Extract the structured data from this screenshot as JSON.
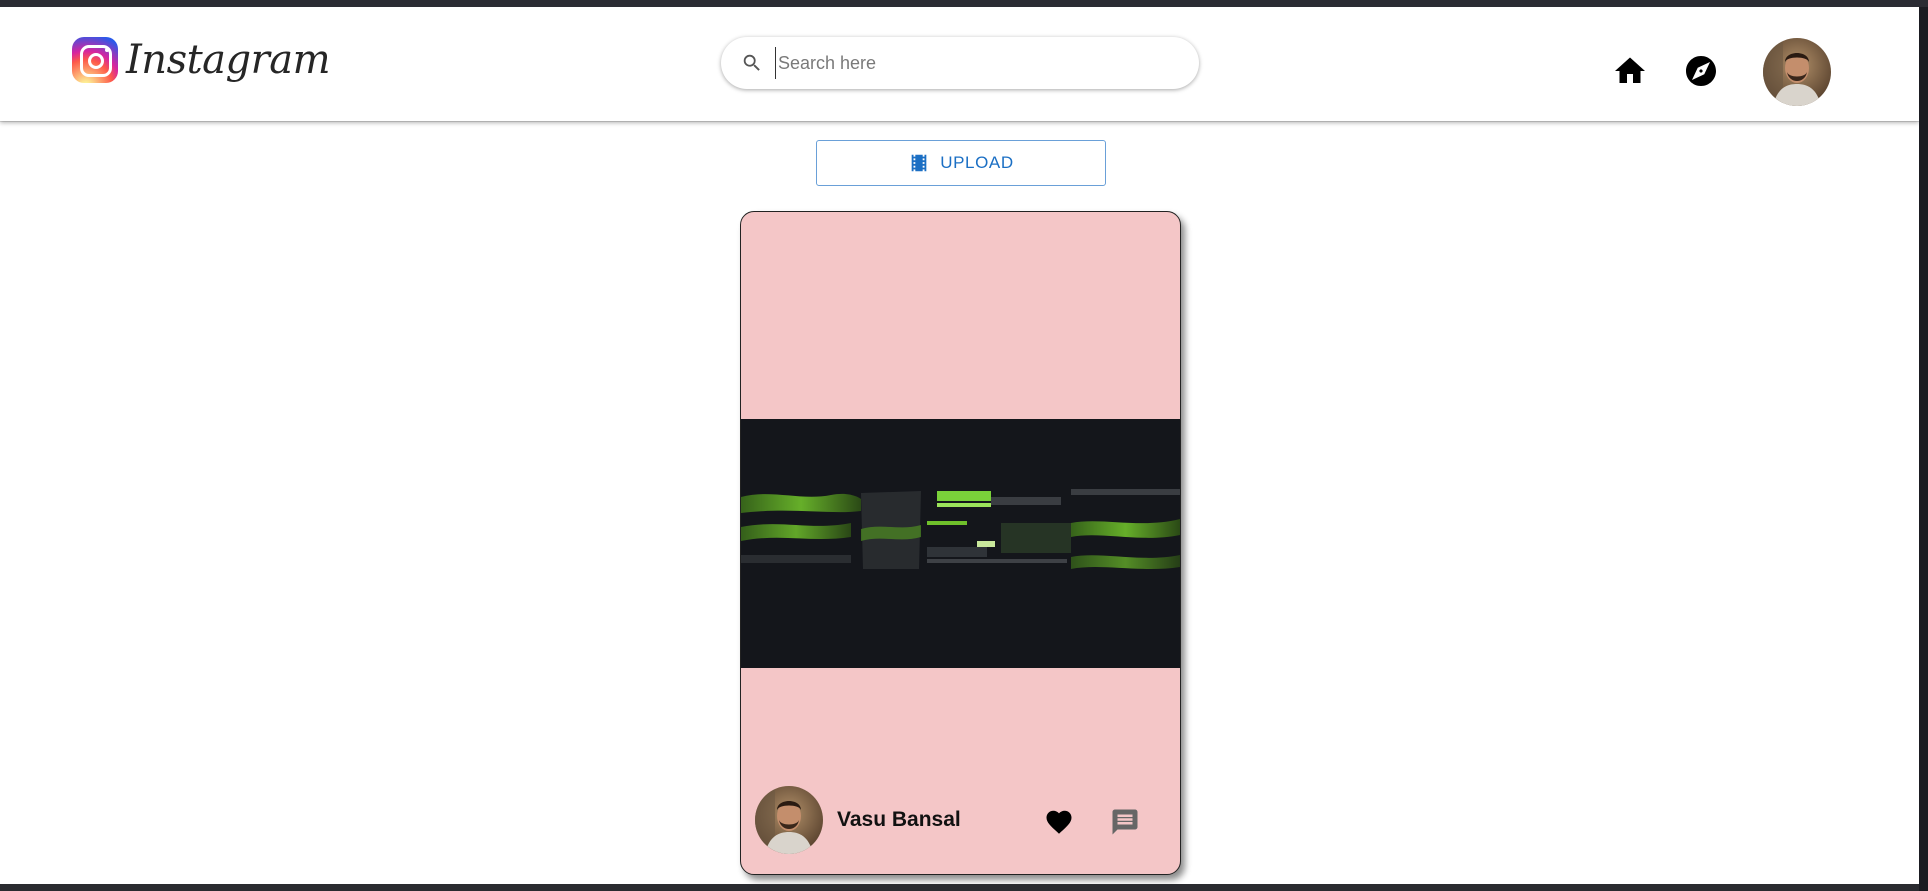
{
  "header": {
    "logo_text": "Instagram",
    "search": {
      "placeholder": "Search here",
      "value": ""
    },
    "nav": {
      "home_icon": "home-icon",
      "explore_icon": "compass-icon"
    },
    "avatar_icon": "avatar"
  },
  "toolbar": {
    "upload_label": "UPLOAD",
    "upload_icon": "film-icon",
    "accent": "#1b6fc4"
  },
  "feed": {
    "posts": [
      {
        "username": "Vasu Bansal",
        "card_color": "#f4c6c7",
        "like_icon": "heart-icon",
        "comment_icon": "comment-icon"
      }
    ]
  }
}
